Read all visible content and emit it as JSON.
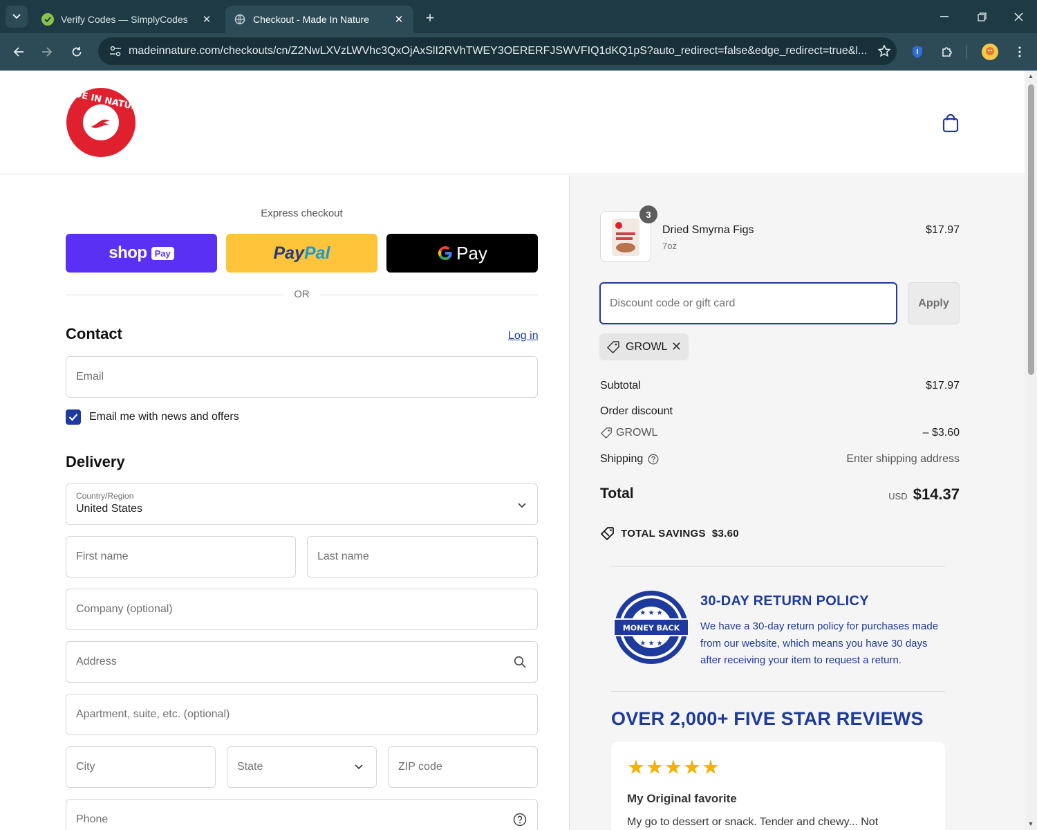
{
  "browser": {
    "tabs": [
      {
        "title": "Verify Codes — SimplyCodes",
        "active": false,
        "favicon": "simplycodes-icon"
      },
      {
        "title": "Checkout - Made In Nature",
        "active": true,
        "favicon": "globe-icon"
      }
    ],
    "url": "madeinnature.com/checkouts/cn/Z2NwLXVzLWVhc3QxOjAxSlI2RVhTWEY3OERERFJSWVFIQ1dKQ1pS?auto_redirect=false&edge_redirect=true&l..."
  },
  "colors": {
    "accent": "#1d3a9c",
    "brand_red": "#e0202e",
    "shop_pay": "#5a31f4",
    "paypal": "#ffc439"
  },
  "express": {
    "label": "Express checkout",
    "shop_label": "shop",
    "shop_badge": "Pay",
    "paypal_pay": "Pay",
    "paypal_pal": "Pal",
    "gpay_label": "Pay",
    "or": "OR"
  },
  "contact": {
    "title": "Contact",
    "login": "Log in",
    "email_placeholder": "Email",
    "newsletter_label": "Email me with news and offers",
    "newsletter_checked": true
  },
  "delivery": {
    "title": "Delivery",
    "country_label": "Country/Region",
    "country_value": "United States",
    "first_name": "First name",
    "last_name": "Last name",
    "company": "Company (optional)",
    "address": "Address",
    "apartment": "Apartment, suite, etc. (optional)",
    "city": "City",
    "state": "State",
    "zip": "ZIP code",
    "phone": "Phone"
  },
  "order": {
    "product": {
      "name": "Dried Smyrna Figs",
      "variant": "7oz",
      "price": "$17.97",
      "quantity": "3"
    },
    "discount_placeholder": "Discount code or gift card",
    "apply": "Apply",
    "applied_code": "GROWL",
    "subtotal_label": "Subtotal",
    "subtotal": "$17.97",
    "order_discount_label": "Order discount",
    "discount_code": "GROWL",
    "discount_amount": "– $3.60",
    "shipping_label": "Shipping",
    "shipping_value": "Enter shipping address",
    "total_label": "Total",
    "currency": "USD",
    "total": "$14.37",
    "savings_label": "TOTAL SAVINGS",
    "savings_amount": "$3.60"
  },
  "promo": {
    "policy_title": "30-DAY RETURN POLICY",
    "policy_text": "We have a 30-day return policy for purchases made from our website, which means you have 30 days after receiving your item to request a return.",
    "reviews_title": "OVER 2,000+ FIVE STAR REVIEWS",
    "review": {
      "stars": "★★★★★",
      "rating": 5,
      "title": "My Original favorite",
      "body": "My go to dessert or snack. Tender and chewy... Not"
    }
  }
}
